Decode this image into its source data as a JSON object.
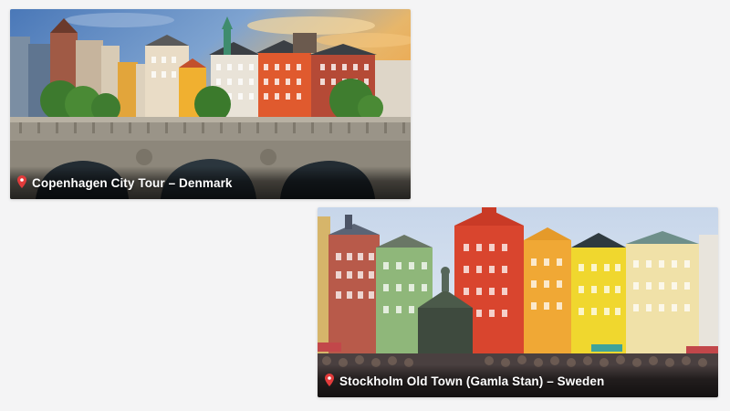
{
  "cards": [
    {
      "title": "Copenhagen City Tour – Denmark",
      "icon": "location-pin-icon",
      "pin_color": "#e23b3b"
    },
    {
      "title": "Stockholm Old Town (Gamla Stan) – Sweden",
      "icon": "location-pin-icon",
      "pin_color": "#e23b3b"
    }
  ]
}
